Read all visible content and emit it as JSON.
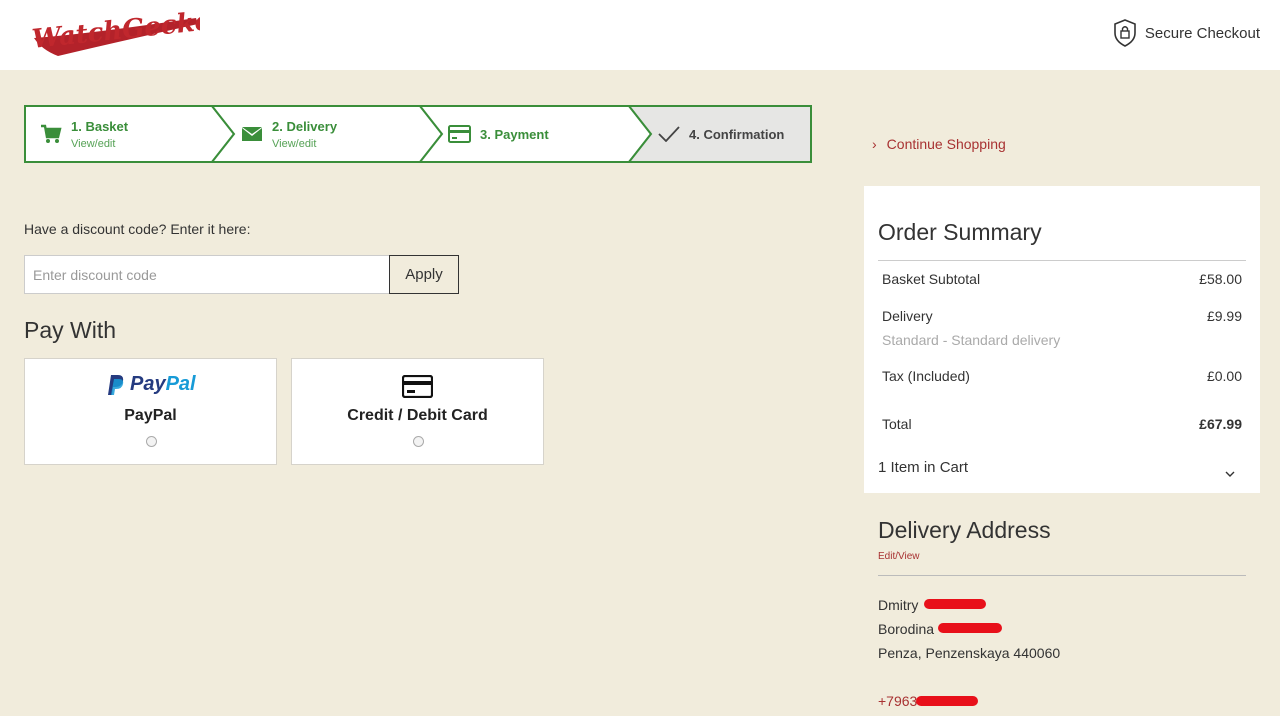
{
  "header": {
    "logo_text": "WatchGecko",
    "secure_label": "Secure Checkout"
  },
  "steps": [
    {
      "title": "1. Basket",
      "sub": "View/edit",
      "icon": "cart-icon"
    },
    {
      "title": "2. Delivery",
      "sub": "View/edit",
      "icon": "envelope-icon"
    },
    {
      "title": "3. Payment",
      "sub": "",
      "icon": "credit-card-icon"
    },
    {
      "title": "4. Confirmation",
      "sub": "",
      "icon": "check-icon"
    }
  ],
  "discount": {
    "label": "Have a discount code? Enter it here:",
    "placeholder": "Enter discount code",
    "apply_label": "Apply"
  },
  "payment": {
    "heading": "Pay With",
    "options": [
      {
        "name": "PayPal",
        "logo_text": "PayPal",
        "icon": "paypal-icon"
      },
      {
        "name": "Credit / Debit Card",
        "icon": "credit-card-icon"
      }
    ]
  },
  "continue_label": "Continue Shopping",
  "summary": {
    "title": "Order Summary",
    "rows": [
      {
        "label": "Basket Subtotal",
        "value": "£58.00"
      },
      {
        "label": "Delivery",
        "sub": "Standard - Standard delivery",
        "value": "£9.99"
      },
      {
        "label": "Tax (Included)",
        "value": "£0.00"
      },
      {
        "label": "Total",
        "value": "£67.99"
      }
    ],
    "cart_count": "1 Item in Cart"
  },
  "delivery": {
    "title": "Delivery Address",
    "edit_label": "Edit/View",
    "lines": [
      "Dmitry",
      "Borodina",
      "Penza, Penzenskaya 440060",
      "+7963"
    ]
  },
  "colors": {
    "background": "#f1ecdc",
    "brand_red": "#c0272d",
    "step_green": "#3a8e3a",
    "link_red": "#a83232",
    "redaction": "#e8101a"
  }
}
